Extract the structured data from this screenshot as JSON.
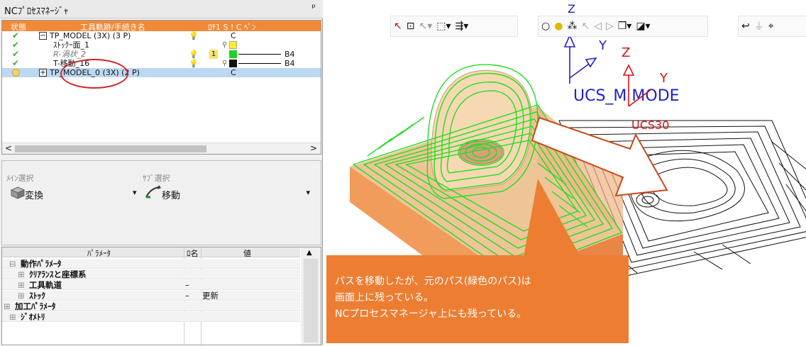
{
  "panel": {
    "title": "NCﾌﾟﾛｾｽﾏﾈｰｼﾞｬ",
    "pin": "ᵖ"
  },
  "tree": {
    "headers": {
      "status": "状態",
      "name": "工具軌跡/手続き名",
      "flags": "ﾛﾁ1 S ! C ﾍﾟﾝ"
    },
    "rows": [
      {
        "icon": "check",
        "label": "TP_MODEL (3X) (3 P)",
        "col_c": "C"
      },
      {
        "icon": "check",
        "label": "ｽﾄｯｸｰ面_1"
      },
      {
        "icon": "check",
        "label": "R-渦状_2",
        "num": "1",
        "b4": "B4"
      },
      {
        "icon": "check",
        "label": "T-移動_16",
        "b4": "B4"
      },
      {
        "icon": "warn",
        "label": "TP_MODEL_0 (3X) (2 P)",
        "col_c": "C"
      }
    ],
    "scroll_left": "<",
    "scroll_right": ">"
  },
  "selection": {
    "main_label": "ﾒｲﾝ選択",
    "sub_label": "ｻﾌﾞ選択",
    "main_value": "変換",
    "sub_value": "移動"
  },
  "params": {
    "headers": {
      "name": "ﾊﾟﾗﾒｰﾀ",
      "flag": "ﾛ名",
      "value": "値"
    },
    "rows": [
      {
        "prefix": "⊟",
        "label": "動作ﾊﾟﾗﾒｰﾀ",
        "indent": 1,
        "c2": "",
        "c3": ""
      },
      {
        "prefix": "⊞",
        "label": "ｸﾘｱﾗﾝｽと座標系",
        "indent": 2,
        "c2": "",
        "c3": ""
      },
      {
        "prefix": "⊞",
        "label": "工具軌道",
        "indent": 2,
        "c2": "–",
        "c3": ""
      },
      {
        "prefix": "⊞",
        "label": "ｽﾄｯｸ",
        "indent": 2,
        "c2": "–",
        "c3": "更新"
      },
      {
        "prefix": "⊞",
        "label": "加工ﾊﾟﾗﾒｰﾀ",
        "indent": 0,
        "c2": "",
        "c3": ""
      },
      {
        "prefix": "⊞",
        "label": "ｼﾞｵﾒﾄﾘ",
        "indent": 1,
        "c2": "",
        "c3": ""
      }
    ]
  },
  "viewport": {
    "axis_y": "Y",
    "axis_z": "Z",
    "axis_z_top": "Z",
    "ucs_blue": "UCS_M MODE",
    "ucs_red_axis": "Y",
    "ucs_red": "UCS30"
  },
  "callout": {
    "line1": "パスを移動したが、元のパス(緑色のパス)は",
    "line2": "画面上に残っている。",
    "line3": "NCプロセスマネージャ上にも残っている。"
  },
  "colors": {
    "accent_orange": "#f08a38",
    "callout_orange": "#ed7d31",
    "path_green": "#22dd22",
    "selection_blue": "#bcd8f3"
  }
}
